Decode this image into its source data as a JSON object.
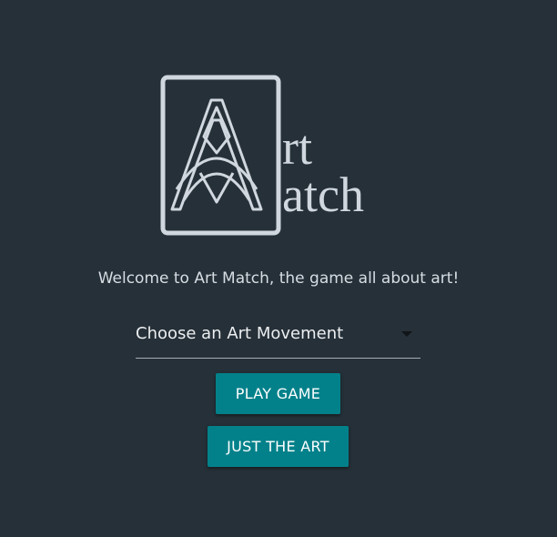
{
  "logo": {
    "line1": "rt",
    "line2": "atch",
    "name": "art-match-logo"
  },
  "welcome_text": "Welcome to Art Match, the game all about art!",
  "movement_select": {
    "value": "Choose an Art Movement",
    "icon": "caret-down-icon"
  },
  "buttons": {
    "play_label": "PLAY GAME",
    "art_label": "JUST THE ART"
  },
  "colors": {
    "background": "#263038",
    "accent": "#03818a",
    "logo": "#d0d7de"
  }
}
